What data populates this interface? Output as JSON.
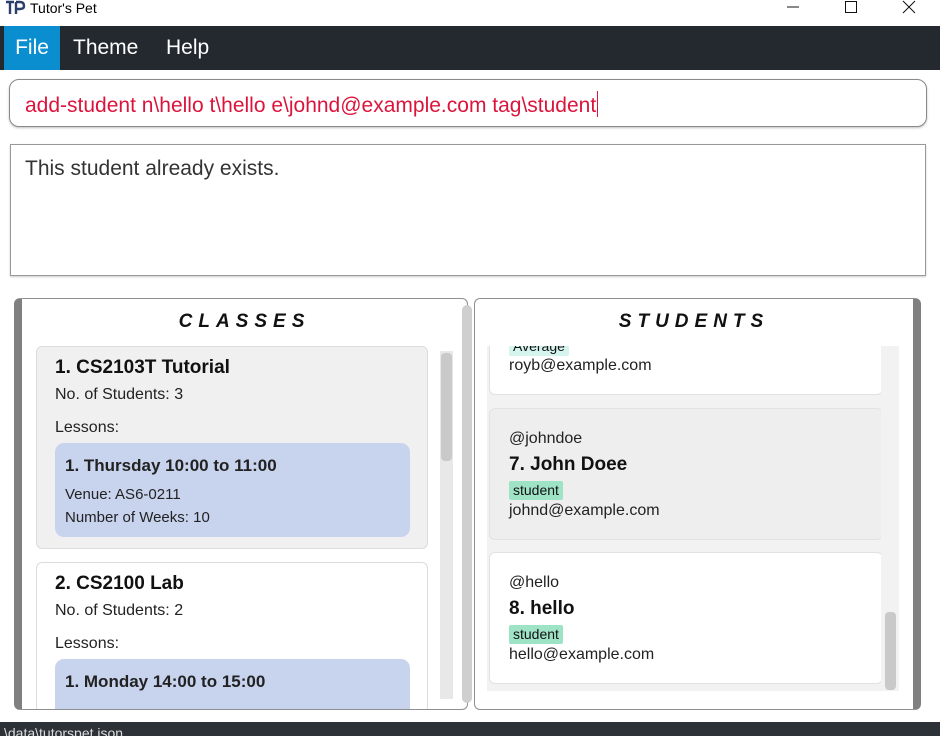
{
  "window": {
    "title": "Tutor's Pet"
  },
  "menu": {
    "file": "File",
    "theme": "Theme",
    "help": "Help"
  },
  "command": {
    "value": "add-student n\\hello t\\hello e\\johnd@example.com tag\\student"
  },
  "result": {
    "text": "This student already exists."
  },
  "classes": {
    "header": "CLASSES",
    "items": [
      {
        "title": "1.  CS2103T Tutorial",
        "students_label": "No. of Students:",
        "students_count": "3",
        "lessons_label": "Lessons:",
        "lesson": {
          "title": "1. Thursday 10:00 to 11:00",
          "venue": "Venue: AS6-0211",
          "weeks": "Number of Weeks: 10"
        }
      },
      {
        "title": "2.  CS2100 Lab",
        "students_label": "No. of Students:",
        "students_count": "2",
        "lessons_label": "Lessons:",
        "lesson": {
          "title": "1. Monday 14:00 to 15:00"
        }
      }
    ]
  },
  "students": {
    "header": "STUDENTS",
    "items": [
      {
        "tag": "Average",
        "email": "royb@example.com"
      },
      {
        "handle": "@johndoe",
        "name": "7.  John Doee",
        "tag": "student",
        "email": "johnd@example.com"
      },
      {
        "handle": "@hello",
        "name": "8.  hello",
        "tag": "student",
        "email": "hello@example.com"
      }
    ]
  },
  "status": {
    "text": "\\data\\tutorspet.json"
  }
}
